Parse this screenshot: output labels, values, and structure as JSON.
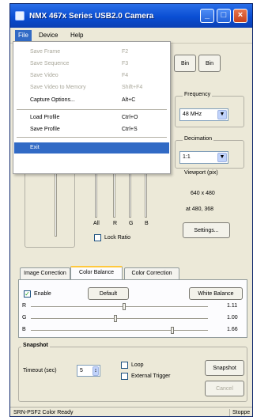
{
  "window": {
    "title": "NMX 467x Series USB2.0 Camera",
    "buttons": {
      "minimize": "_",
      "maximize": "□",
      "close": "×"
    }
  },
  "menubar": {
    "file": "File",
    "device": "Device",
    "help": "Help"
  },
  "file_menu": [
    {
      "label": "Save Frame",
      "shortcut": "F2",
      "enabled": false
    },
    {
      "label": "Save Sequence",
      "shortcut": "F3",
      "enabled": false
    },
    {
      "label": "Save Video",
      "shortcut": "F4",
      "enabled": false
    },
    {
      "label": "Save Video to Memory",
      "shortcut": "Shift+F4",
      "enabled": false
    },
    {
      "label": "Capture Options...",
      "shortcut": "Alt+C",
      "enabled": true
    },
    {
      "label": "Load Profile",
      "shortcut": "Ctrl+O",
      "enabled": true
    },
    {
      "label": "Save Profile",
      "shortcut": "Ctrl+S",
      "enabled": true
    },
    {
      "label": "Exit",
      "shortcut": "",
      "enabled": true,
      "highlighted": true
    }
  ],
  "toolbar": {
    "btn1": "Bin",
    "btn2": "Bin"
  },
  "frequency": {
    "title": "Frequency",
    "value": "48 MHz"
  },
  "decimation": {
    "title": "Decimation",
    "value": "1:1"
  },
  "viewport": {
    "title": "Viewport (pix)",
    "size": "640 x 480",
    "position": "at 480, 368",
    "settings_button": "Settings..."
  },
  "gain": {
    "labels": [
      "All",
      "R",
      "G",
      "B"
    ],
    "levels": [
      0.85,
      0.85,
      0.85,
      0.85
    ],
    "lock_ratio": "Lock Ratio"
  },
  "tabs": [
    "Image Correction",
    "Color Balance",
    "Color Correction"
  ],
  "color_balance": {
    "enable_label": "Enable",
    "default_button": "Default",
    "white_balance_button": "White Balance",
    "rows": [
      {
        "channel": "R",
        "value": "1.11",
        "position": 0.52
      },
      {
        "channel": "G",
        "value": "1.00",
        "position": 0.47
      },
      {
        "channel": "B",
        "value": "1.66",
        "position": 0.79
      }
    ]
  },
  "snapshot": {
    "title": "Snapshot",
    "timeout_label": "Timeout (sec)",
    "timeout_value": "5",
    "loop_label": "Loop",
    "external_trigger_label": "External Trigger",
    "snapshot_button": "Snapshot",
    "cancel_button": "Cancel"
  },
  "statusbar": {
    "left": "SRN-PSF2 Color Ready",
    "right": "Stoppe"
  }
}
